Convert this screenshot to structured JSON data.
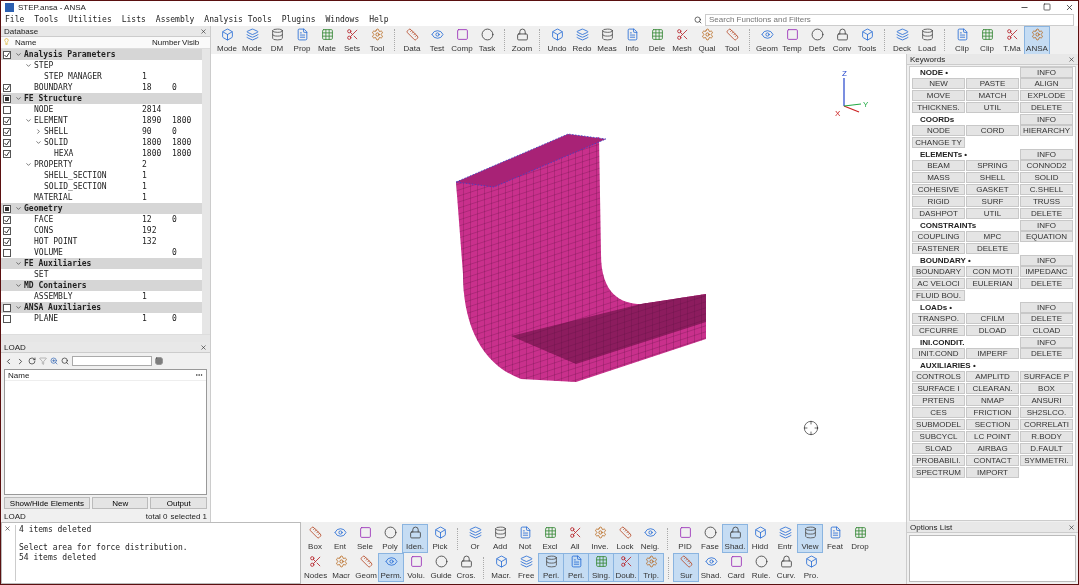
{
  "window": {
    "title": "STEP.ansa - ANSA"
  },
  "menu": [
    "File",
    "Tools",
    "Utilities",
    "Lists",
    "Assembly",
    "Analysis Tools",
    "Plugins",
    "Windows",
    "Help"
  ],
  "search": {
    "placeholder": "Search Functions and Filters"
  },
  "toolbar": [
    [
      {
        "label": "Mode",
        "selected": false
      },
      {
        "label": "Mode",
        "selected": false
      },
      {
        "label": "DM",
        "selected": false
      },
      {
        "label": "Prop",
        "selected": false
      },
      {
        "label": "Mate",
        "selected": false
      },
      {
        "label": "Sets",
        "selected": false
      },
      {
        "label": "Tool",
        "selected": false
      }
    ],
    [
      {
        "label": "Data",
        "selected": false
      },
      {
        "label": "Test",
        "selected": false
      },
      {
        "label": "Comp",
        "selected": false
      },
      {
        "label": "Task",
        "selected": false
      }
    ],
    [
      {
        "label": "Zoom",
        "selected": false
      }
    ],
    [
      {
        "label": "Undo",
        "selected": false
      },
      {
        "label": "Redo",
        "selected": false
      },
      {
        "label": "Meas",
        "selected": false
      },
      {
        "label": "Info",
        "selected": false
      },
      {
        "label": "Dele",
        "selected": false
      },
      {
        "label": "Mesh",
        "selected": false
      },
      {
        "label": "Qual",
        "selected": false
      },
      {
        "label": "Tool",
        "selected": false
      }
    ],
    [
      {
        "label": "Geom",
        "selected": false
      },
      {
        "label": "Temp",
        "selected": false
      },
      {
        "label": "Defs",
        "selected": false
      },
      {
        "label": "Conv",
        "selected": false
      },
      {
        "label": "Tools",
        "selected": false
      }
    ],
    [
      {
        "label": "Deck",
        "selected": false
      },
      {
        "label": "Load",
        "selected": false
      }
    ],
    [
      {
        "label": "Clip",
        "selected": false
      },
      {
        "label": "Clip",
        "selected": false
      },
      {
        "label": "T.Ma",
        "selected": false
      },
      {
        "label": "ANSA",
        "selected": true
      }
    ]
  ],
  "database": {
    "title": "Database",
    "columns": [
      "Name",
      "Number",
      "Visib"
    ],
    "rows": [
      {
        "name": "Analysis Parameters",
        "checked": true,
        "expanded": true,
        "children": [
          {
            "name": "STEP",
            "expanded": true,
            "children": [
              {
                "name": "STEP MANAGER",
                "number": "1"
              }
            ]
          },
          {
            "name": "BOUNDARY",
            "checked": true,
            "number": "18",
            "visible": "0"
          }
        ]
      },
      {
        "name": "FE Structure",
        "mixed": true,
        "expanded": true,
        "children": [
          {
            "name": "NODE",
            "checked": false,
            "number": "2814"
          },
          {
            "name": "ELEMENT",
            "checked": true,
            "number": "1890",
            "visible": "1800",
            "expanded": true,
            "children": [
              {
                "name": "SHELL",
                "checked": true,
                "number": "90",
                "visible": "0",
                "expanded": false
              },
              {
                "name": "SOLID",
                "checked": true,
                "number": "1800",
                "visible": "1800",
                "expanded": true,
                "children": [
                  {
                    "name": "HEXA",
                    "checked": true,
                    "number": "1800",
                    "visible": "1800"
                  }
                ]
              }
            ]
          },
          {
            "name": "PROPERTY",
            "number": "2",
            "expanded": true,
            "children": [
              {
                "name": "SHELL_SECTION",
                "number": "1"
              },
              {
                "name": "SOLID_SECTION",
                "number": "1"
              }
            ]
          },
          {
            "name": "MATERIAL",
            "number": "1"
          }
        ]
      },
      {
        "name": "Geometry",
        "mixed": true,
        "expanded": true,
        "children": [
          {
            "name": "FACE",
            "checked": true,
            "number": "12",
            "visible": "0"
          },
          {
            "name": "CONS",
            "checked": true,
            "number": "192"
          },
          {
            "name": "HOT POINT",
            "checked": true,
            "number": "132"
          },
          {
            "name": "VOLUME",
            "checked": false,
            "visible": "0"
          }
        ]
      },
      {
        "name": "FE Auxiliaries",
        "expanded": true,
        "children": [
          {
            "name": "SET"
          }
        ]
      },
      {
        "name": "MD Containers",
        "expanded": true,
        "children": [
          {
            "name": "ASSEMBLY",
            "number": "1"
          }
        ]
      },
      {
        "name": "ANSA Auxiliaries",
        "checked": false,
        "expanded": true,
        "children": [
          {
            "name": "PLANE",
            "checked": false,
            "number": "1",
            "visible": "0"
          }
        ]
      }
    ]
  },
  "load_panel": {
    "title": "LOAD",
    "column": "Name",
    "buttons": [
      "Show/Hide Elements",
      "New",
      "Output"
    ],
    "status": {
      "label": "LOAD",
      "total": "total 0",
      "selected": "selected 1"
    }
  },
  "console": {
    "blocks": [
      [
        "4 items deleted"
      ],
      [
        "Select area for force distribution.",
        "54 items deleted"
      ]
    ]
  },
  "viewport": {
    "axis_labels": [
      "Z",
      "X",
      "Y"
    ]
  },
  "keywords": {
    "title": "Keywords",
    "sections": [
      {
        "title": "NODE •",
        "info": "INFO",
        "buttons": [
          "NEW",
          "PASTE",
          "ALIGN",
          "MOVE",
          "MATCH",
          "EXPLODE",
          "THICKNES.",
          "UTIL",
          "DELETE"
        ]
      },
      {
        "title": "COORDs",
        "info": "INFO",
        "buttons": [
          "NODE",
          "CORD",
          "HIERARCHY",
          "CHANGE TY"
        ]
      },
      {
        "title": "ELEMENTs •",
        "info": "INFO",
        "buttons": [
          "BEAM",
          "SPRING",
          "CONNOD2",
          "MASS",
          "SHELL",
          "SOLID",
          "COHESIVE",
          "GASKET",
          "C.SHELL",
          "RIGID",
          "SURF",
          "TRUSS",
          "DASHPOT",
          "UTIL",
          "DELETE"
        ]
      },
      {
        "title": "CONSTRAINTs",
        "info": "INFO",
        "buttons": [
          "COUPLING",
          "MPC",
          "EQUATION",
          "FASTENER",
          "DELETE"
        ]
      },
      {
        "title": "BOUNDARY •",
        "info": "INFO",
        "buttons": [
          "BOUNDARY",
          "CON MOTI",
          "IMPEDANC",
          "AC VELOCI",
          "EULERIAN",
          "DELETE",
          "FLUID BOU."
        ]
      },
      {
        "title": "LOADs •",
        "info": "INFO",
        "buttons": [
          "TRANSPO.",
          "CFILM",
          "DELETE",
          "CFCURRE",
          "DLOAD",
          "CLOAD"
        ]
      },
      {
        "title": "INI.CONDIT.",
        "info": "INFO",
        "buttons": [
          "INIT.COND",
          "IMPERF",
          "DELETE"
        ]
      },
      {
        "title": "AUXILIARIES •",
        "buttons": [
          "CONTROLS",
          "AMPLITD",
          "SURFACE P",
          "SURFACE I",
          "CLEARAN.",
          "BOX",
          "PRTENS",
          "NMAP",
          "ANSURI",
          "CES",
          "FRICTION",
          "SH2SLCO.",
          "SUBMODEL",
          "SECTION",
          "CORRELATI",
          "SUBCYCL",
          "LC POINT",
          "R.BODY",
          "SLOAD",
          "AIRBAG",
          "D.FAULT",
          "PROBABILI.",
          "CONTACT",
          "SYMMETRI.",
          "SPECTRUM",
          "IMPORT"
        ]
      }
    ]
  },
  "options_list": {
    "title": "Options List"
  },
  "bottom_toolbar": [
    [
      [
        {
          "label": "Box",
          "selected": false
        },
        {
          "label": "Ent",
          "selected": false
        },
        {
          "label": "Sele",
          "selected": false
        },
        {
          "label": "Poly",
          "selected": false
        },
        {
          "label": "Iden.",
          "selected": true
        },
        {
          "label": "Pick",
          "selected": false
        }
      ],
      [
        {
          "label": "Or",
          "selected": false
        },
        {
          "label": "Add",
          "selected": false
        },
        {
          "label": "Not",
          "selected": false
        },
        {
          "label": "Excl",
          "selected": false
        },
        {
          "label": "All",
          "selected": false
        },
        {
          "label": "Inve.",
          "selected": false
        },
        {
          "label": "Lock",
          "selected": false
        },
        {
          "label": "Neig.",
          "selected": false
        }
      ],
      [
        {
          "label": "PID",
          "selected": false
        },
        {
          "label": "Fase",
          "selected": false
        },
        {
          "label": "Shad.",
          "selected": true
        },
        {
          "label": "Hidd",
          "selected": false
        },
        {
          "label": "Entr",
          "selected": false
        },
        {
          "label": "View",
          "selected": true
        },
        {
          "label": "Feat",
          "selected": false
        },
        {
          "label": "Drop",
          "selected": false
        }
      ]
    ],
    [
      [
        {
          "label": "Nodes",
          "selected": false
        },
        {
          "label": "Macr",
          "selected": false
        },
        {
          "label": "Geom",
          "selected": false
        },
        {
          "label": "Perm.",
          "selected": true
        },
        {
          "label": "Volu.",
          "selected": false
        },
        {
          "label": "Guide",
          "selected": false
        },
        {
          "label": "Cros.",
          "selected": false
        }
      ],
      [
        {
          "label": "Macr.",
          "selected": false
        },
        {
          "label": "Free",
          "selected": false
        },
        {
          "label": "Peri.",
          "selected": true
        },
        {
          "label": "Peri.",
          "selected": true
        },
        {
          "label": "Sing.",
          "selected": true
        },
        {
          "label": "Doub.",
          "selected": true
        },
        {
          "label": "Trip.",
          "selected": true
        }
      ],
      [
        {
          "label": "Sur",
          "selected": true
        },
        {
          "label": "Shad.",
          "selected": false
        },
        {
          "label": "Card",
          "selected": false
        },
        {
          "label": "Rule.",
          "selected": false
        },
        {
          "label": "Curv.",
          "selected": false
        },
        {
          "label": "Pro.",
          "selected": false
        }
      ]
    ]
  ]
}
